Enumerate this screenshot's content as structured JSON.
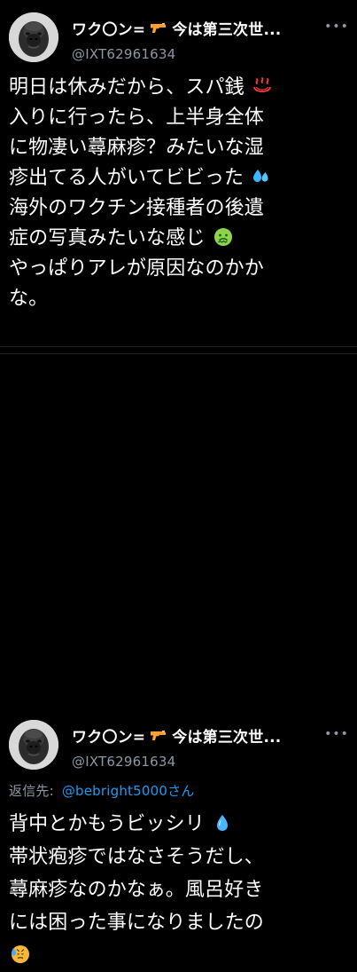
{
  "tweets": [
    {
      "display_name_before_icon": "ワク〇ン=",
      "display_name_after_icon": "今は第三次世...",
      "handle": "@IXT62961634",
      "more_icon": "more-icon",
      "body_lines": [
        "明日は休みだから、スパ銭",
        "入りに行ったら、上半身全体",
        "に物凄い蕁麻疹？みたいな湿",
        "疹出てる人がいてビビった",
        "海外のワクチン接種者の後遺",
        "症の写真みたいな感じ",
        "やっぱりアレが原因なのかか",
        "な。"
      ],
      "emojis": [
        "hot-springs-icon",
        "sweat-droplets-icon",
        "nauseated-face-icon"
      ]
    },
    {
      "display_name_before_icon": "ワク〇ン=",
      "display_name_after_icon": "今は第三次世...",
      "handle": "@IXT62961634",
      "reply_prefix": "返信先:",
      "reply_mention": "@bebright5000さん",
      "body_lines": [
        "背中とかもうビッシリ",
        "帯状疱疹ではなさそうだし、",
        "蕁麻疹なのかなぁ。風呂好き",
        "には困った事になりましたの"
      ],
      "emojis": [
        "droplet-icon",
        "disappointed-face-icon"
      ]
    }
  ],
  "colors": {
    "background": "#000000",
    "text": "#ffffff",
    "secondary_text": "#8b98a5",
    "link": "#1d9bf0",
    "divider": "#222222"
  },
  "icons": {
    "avatar": "gorilla-avatar",
    "gun": "pistol-icon"
  }
}
